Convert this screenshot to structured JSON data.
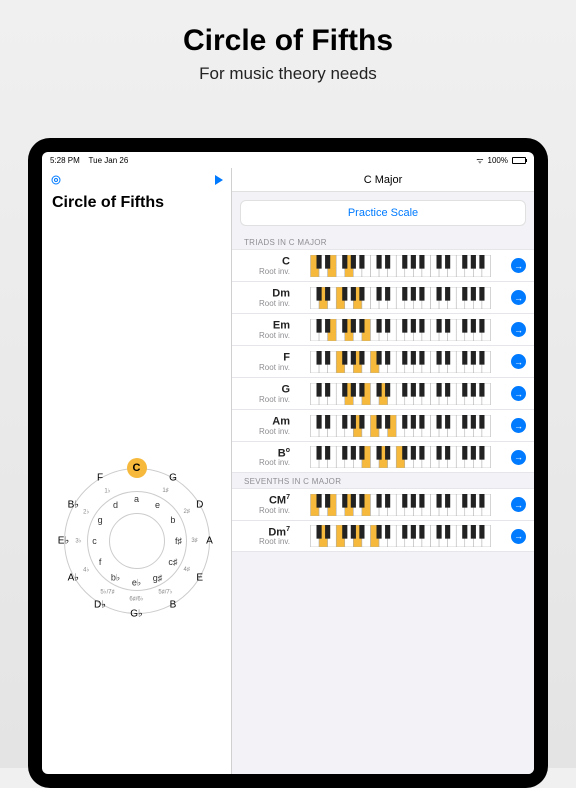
{
  "promo": {
    "title": "Circle of Fifths",
    "subtitle": "For music theory needs"
  },
  "statusbar": {
    "time": "5:28 PM",
    "date": "Tue Jan 26",
    "battery": "100%"
  },
  "left": {
    "title": "Circle of Fifths"
  },
  "right": {
    "title": "C Major",
    "practice_label": "Practice Scale",
    "section_triads": "TRIADS IN C MAJOR",
    "section_sevenths": "SEVENTHS IN C MAJOR"
  },
  "triads": [
    {
      "name": "C",
      "sup": "",
      "sub": "Root inv.",
      "hl_white": [
        0,
        2,
        4
      ]
    },
    {
      "name": "Dm",
      "sup": "",
      "sub": "Root inv.",
      "hl_white": [
        1,
        3,
        5
      ]
    },
    {
      "name": "Em",
      "sup": "",
      "sub": "Root inv.",
      "hl_white": [
        2,
        4,
        6
      ]
    },
    {
      "name": "F",
      "sup": "",
      "sub": "Root inv.",
      "hl_white": [
        3,
        5,
        7
      ]
    },
    {
      "name": "G",
      "sup": "",
      "sub": "Root inv.",
      "hl_white": [
        4,
        6,
        8
      ]
    },
    {
      "name": "Am",
      "sup": "",
      "sub": "Root inv.",
      "hl_white": [
        5,
        7,
        9
      ]
    },
    {
      "name": "B",
      "sup": "o",
      "sub": "Root inv.",
      "hl_white": [
        6,
        8,
        10
      ]
    }
  ],
  "sevenths": [
    {
      "name": "CM",
      "sup": "7",
      "sub": "Root inv.",
      "hl_white": [
        0,
        2,
        4,
        6
      ]
    },
    {
      "name": "Dm",
      "sup": "7",
      "sub": "Root inv.",
      "hl_white": [
        1,
        3,
        5,
        7
      ]
    }
  ],
  "cof": {
    "outer": [
      "C",
      "G",
      "D",
      "A",
      "E",
      "B",
      "G♭",
      "D♭",
      "A♭",
      "E♭",
      "B♭",
      "F"
    ],
    "minor": [
      "a",
      "e",
      "b",
      "f♯",
      "c♯",
      "g♯",
      "e♭",
      "b♭",
      "f",
      "c",
      "g",
      "d"
    ],
    "sigs": [
      "",
      "1♯",
      "2♯",
      "3♯",
      "4♯",
      "5♯/7♭",
      "6♯/6♭",
      "5♭/7♯",
      "4♭",
      "3♭",
      "2♭",
      "1♭"
    ],
    "selected_index": 0
  },
  "colors": {
    "accent": "#007aff",
    "highlight": "#f6b93b"
  }
}
